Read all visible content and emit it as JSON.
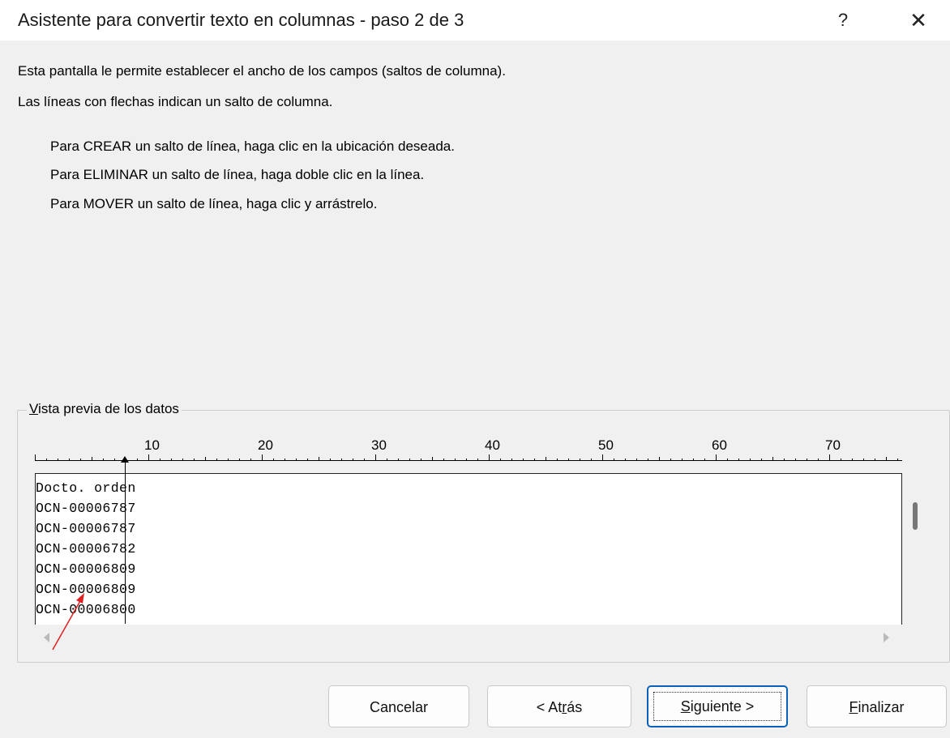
{
  "window": {
    "title": "Asistente para convertir texto en columnas - paso 2 de 3",
    "help_label": "?",
    "close_label": "✕"
  },
  "description": {
    "line1": "Esta pantalla le permite establecer el ancho de los campos (saltos de columna).",
    "line2": "Las líneas con flechas indican un salto de columna."
  },
  "instructions": [
    "Para CREAR un salto de línea, haga clic en la ubicación deseada.",
    "Para ELIMINAR un salto de línea, haga doble clic en la línea.",
    "Para MOVER un salto de línea, haga clic y arrástrelo."
  ],
  "preview": {
    "label_access_key": "V",
    "label_rest": "ista previa de los datos",
    "ruler_numbers": [
      "10",
      "20",
      "30",
      "40",
      "50",
      "60",
      "70"
    ],
    "rows": [
      "Docto. orden",
      "OCN-00006787",
      "OCN-00006787",
      "OCN-00006782",
      "OCN-00006809",
      "OCN-00006809",
      "OCN-00006800"
    ]
  },
  "annotation": {
    "arrow_color": "#e02020"
  },
  "buttons": {
    "cancel": "Cancelar",
    "back_pre": "< At",
    "back_key": "r",
    "back_post": "ás",
    "next_key": "S",
    "next_post": "iguiente >",
    "finish_key": "F",
    "finish_post": "inalizar"
  },
  "colors": {
    "dialog_bg": "#f0f0f0",
    "default_button_border": "#0a62b8"
  }
}
